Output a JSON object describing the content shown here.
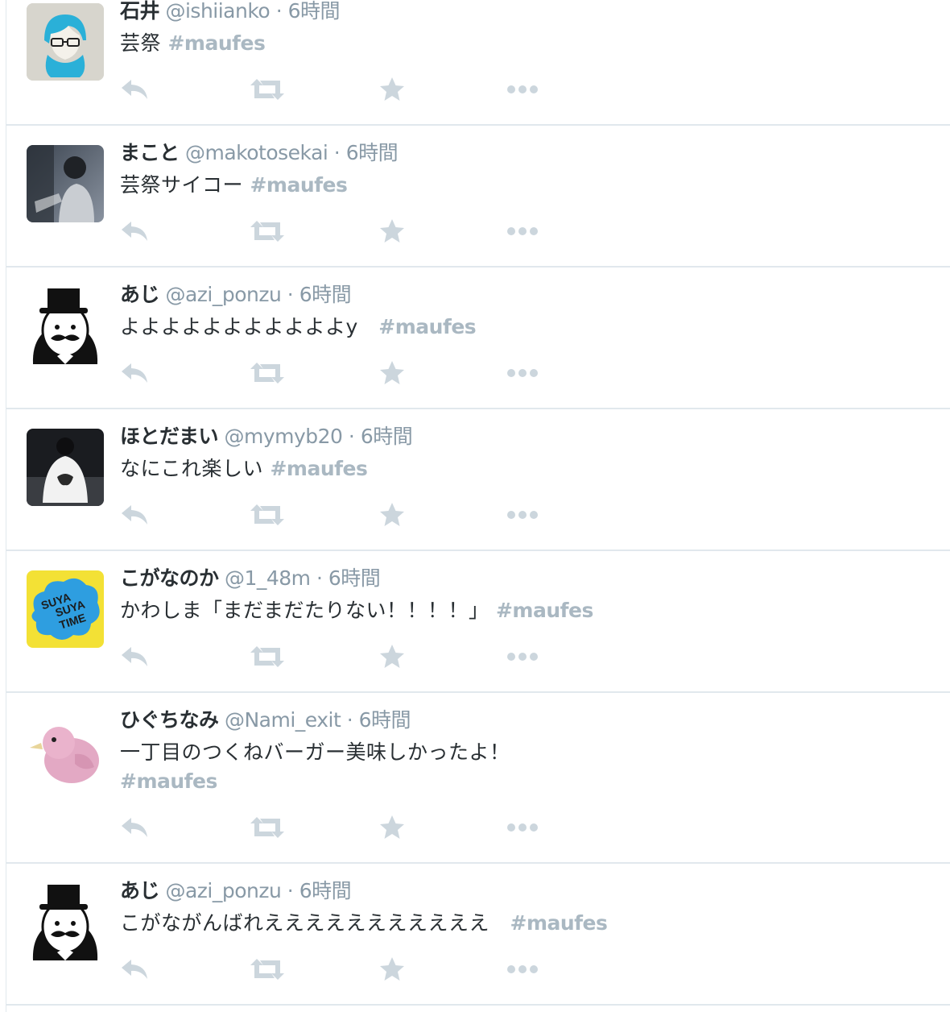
{
  "tweets": [
    {
      "name": "石井",
      "handle": "@ishiianko",
      "dot": "·",
      "time": "6時間",
      "text": "芸祭 ",
      "hashtag": "#maufes",
      "avatar": "blue-hair-illustration-avatar"
    },
    {
      "name": "まこと",
      "handle": "@makotosekai",
      "dot": "·",
      "time": "6時間",
      "text": "芸祭サイコー ",
      "hashtag": "#maufes",
      "avatar": "photo-person-avatar"
    },
    {
      "name": "あじ",
      "handle": "@azi_ponzu",
      "dot": "·",
      "time": "6時間",
      "text": "よよよよよよよよよよよy　",
      "hashtag": "#maufes",
      "avatar": "top-hat-mustache-avatar"
    },
    {
      "name": "ほとだまい",
      "handle": "@mymyb20",
      "dot": "·",
      "time": "6時間",
      "text": "なにこれ楽しい ",
      "hashtag": "#maufes",
      "avatar": "photo-white-shirt-avatar"
    },
    {
      "name": "こがなのか",
      "handle": "@1_48m",
      "dot": "·",
      "time": "6時間",
      "text": "かわしま「まだまだたりない！！！！」 ",
      "hashtag": "#maufes",
      "avatar": "suya-suya-time-avatar",
      "avatar_text": [
        "SUYA",
        "SUYA",
        "TIME"
      ]
    },
    {
      "name": "ひぐちなみ",
      "handle": "@Nami_exit",
      "dot": "·",
      "time": "6時間",
      "text": "一丁目のつくねバーガー美味しかったよ！",
      "hashtag": "#maufes",
      "avatar": "pink-chick-avatar"
    },
    {
      "name": "あじ",
      "handle": "@azi_ponzu",
      "dot": "·",
      "time": "6時間",
      "text": "こがながんばれえええええええええええ　",
      "hashtag": "#maufes",
      "avatar": "top-hat-mustache-avatar"
    }
  ],
  "icons": {
    "reply": "reply-icon",
    "retweet": "retweet-icon",
    "favorite": "star-icon",
    "more": "more-icon"
  },
  "colors": {
    "name": "#292f33",
    "meta": "#8899a6",
    "hashtag": "#aab8c2",
    "icon": "#ccd6dd",
    "divider": "#e1e8ed"
  }
}
